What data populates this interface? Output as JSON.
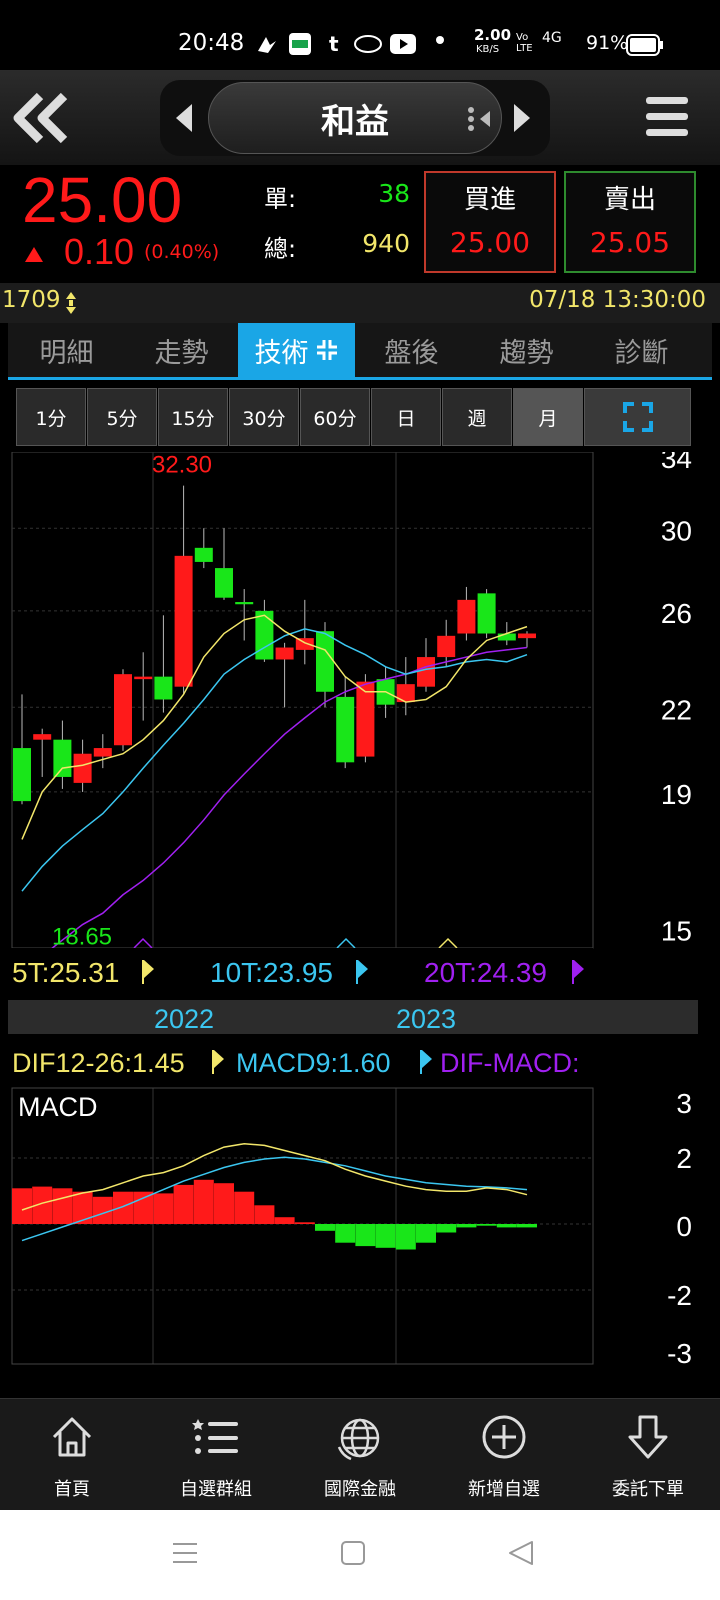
{
  "status_bar": {
    "time": "20:48",
    "net_speed_value": "2.00",
    "net_speed_unit": "KB/S",
    "volte": "Vo LTE",
    "signal": "4G",
    "battery": "91%"
  },
  "header": {
    "stock_name": "和益",
    "back_icon": "double-chevron-left-icon",
    "menu_icon": "hamburger-menu-icon"
  },
  "quote": {
    "price": "25.00",
    "change": "0.10",
    "change_pct": "(0.40%)",
    "single_label": "單:",
    "single_value": "38",
    "total_label": "總:",
    "total_value": "940",
    "buy_label": "買進",
    "buy_price": "25.00",
    "sell_label": "賣出",
    "sell_price": "25.05"
  },
  "info": {
    "code": "1709",
    "datetime": "07/18 13:30:00"
  },
  "tabs": [
    "明細",
    "走勢",
    "技術",
    "盤後",
    "趨勢",
    "診斷"
  ],
  "active_tab": 2,
  "periods": [
    "1分",
    "5分",
    "15分",
    "30分",
    "60分",
    "日",
    "週",
    "月"
  ],
  "active_period": 7,
  "indicators": {
    "ma5": "5T:25.31",
    "ma10": "10T:23.95",
    "ma20": "20T:24.39",
    "dif": "DIF12-26:1.45",
    "macd9": "MACD9:1.60",
    "dif_macd": "DIF-MACD:"
  },
  "macd_label": "MACD",
  "years": [
    "2022",
    "2023"
  ],
  "colors": {
    "up": "#ff1a1a",
    "down": "#19e619",
    "ma5": "#f2e66a",
    "ma10": "#3bc6f0",
    "ma20": "#a020f0",
    "accent": "#1aa6e6"
  },
  "chart_data": [
    {
      "type": "candlestick",
      "title": "",
      "max_label": "32.30",
      "min_label": "18.65",
      "y_ticks": [
        "34",
        "30",
        "26",
        "22",
        "19",
        "15"
      ],
      "candles": [
        {
          "o": 20.5,
          "h": 22.5,
          "l": 18.6,
          "c": 18.7
        },
        {
          "o": 20.8,
          "h": 21.2,
          "l": 19.5,
          "c": 21.0
        },
        {
          "o": 20.8,
          "h": 21.5,
          "l": 19.1,
          "c": 19.5
        },
        {
          "o": 19.3,
          "h": 20.8,
          "l": 19.0,
          "c": 20.3
        },
        {
          "o": 20.2,
          "h": 21.0,
          "l": 19.8,
          "c": 20.5
        },
        {
          "o": 20.6,
          "h": 23.5,
          "l": 20.4,
          "c": 23.3
        },
        {
          "o": 23.1,
          "h": 24.2,
          "l": 21.5,
          "c": 23.2
        },
        {
          "o": 23.2,
          "h": 25.8,
          "l": 21.8,
          "c": 22.3
        },
        {
          "o": 22.8,
          "h": 32.3,
          "l": 22.5,
          "c": 28.6
        },
        {
          "o": 29.0,
          "h": 30.0,
          "l": 28.0,
          "c": 28.3
        },
        {
          "o": 28.0,
          "h": 30.0,
          "l": 26.5,
          "c": 26.6
        },
        {
          "o": 26.4,
          "h": 27.0,
          "l": 24.7,
          "c": 26.3
        },
        {
          "o": 26.0,
          "h": 26.5,
          "l": 23.8,
          "c": 23.9
        },
        {
          "o": 23.9,
          "h": 24.6,
          "l": 22.0,
          "c": 24.4
        },
        {
          "o": 24.3,
          "h": 26.5,
          "l": 23.7,
          "c": 24.8
        },
        {
          "o": 25.1,
          "h": 25.5,
          "l": 22.0,
          "c": 22.6
        },
        {
          "o": 22.4,
          "h": 23.2,
          "l": 19.8,
          "c": 20.0
        },
        {
          "o": 20.2,
          "h": 23.3,
          "l": 20.0,
          "c": 23.0
        },
        {
          "o": 23.1,
          "h": 23.6,
          "l": 21.6,
          "c": 22.1
        },
        {
          "o": 22.2,
          "h": 24.0,
          "l": 21.7,
          "c": 22.9
        },
        {
          "o": 22.8,
          "h": 24.8,
          "l": 22.6,
          "c": 24.0
        },
        {
          "o": 24.0,
          "h": 25.6,
          "l": 23.6,
          "c": 24.9
        },
        {
          "o": 25.0,
          "h": 27.1,
          "l": 24.7,
          "c": 26.5
        },
        {
          "o": 26.8,
          "h": 27.0,
          "l": 24.8,
          "c": 25.0
        },
        {
          "o": 25.0,
          "h": 25.5,
          "l": 24.5,
          "c": 24.7
        },
        {
          "o": 24.8,
          "h": 25.1,
          "l": 24.4,
          "c": 25.0
        }
      ],
      "ma5": [
        17.5,
        19.0,
        19.8,
        19.9,
        20.1,
        20.3,
        20.8,
        21.5,
        22.5,
        24.0,
        25.0,
        25.6,
        25.8,
        25.1,
        24.6,
        24.3,
        23.2,
        22.6,
        22.6,
        22.2,
        22.3,
        22.8,
        23.9,
        24.7,
        25.0,
        25.3
      ],
      "ma10": [
        16.0,
        16.7,
        17.3,
        17.8,
        18.3,
        19.0,
        19.8,
        20.6,
        21.4,
        22.3,
        23.3,
        23.9,
        24.4,
        24.9,
        25.2,
        25.0,
        24.5,
        24.1,
        23.6,
        23.3,
        23.5,
        23.6,
        23.8,
        23.9,
        23.8,
        24.1
      ],
      "ma20": [
        null,
        14.3,
        14.7,
        15.1,
        15.4,
        15.9,
        16.3,
        16.8,
        17.4,
        18.1,
        18.9,
        19.6,
        20.3,
        21.0,
        21.6,
        22.2,
        22.6,
        22.9,
        23.1,
        23.3,
        23.6,
        23.8,
        24.0,
        24.2,
        24.3,
        24.4
      ]
    },
    {
      "type": "macd",
      "title": "",
      "y_ticks": [
        "3",
        "2",
        "0",
        "-2",
        "-3"
      ],
      "dif": [
        1.0,
        1.2,
        1.35,
        1.5,
        1.6,
        1.8,
        2.0,
        2.1,
        2.3,
        2.6,
        2.85,
        2.95,
        2.9,
        2.75,
        2.6,
        2.45,
        2.2,
        2.0,
        1.85,
        1.7,
        1.6,
        1.55,
        1.55,
        1.65,
        1.6,
        1.45
      ],
      "macd9": [
        0.1,
        0.3,
        0.5,
        0.7,
        0.9,
        1.1,
        1.35,
        1.6,
        1.85,
        2.05,
        2.25,
        2.4,
        2.5,
        2.55,
        2.5,
        2.4,
        2.3,
        2.15,
        2.0,
        1.9,
        1.8,
        1.75,
        1.7,
        1.68,
        1.65,
        1.6
      ],
      "osc": [
        1.05,
        1.1,
        1.05,
        0.95,
        0.8,
        0.95,
        0.95,
        0.9,
        1.15,
        1.3,
        1.2,
        0.95,
        0.55,
        0.2,
        0.05,
        -0.2,
        -0.55,
        -0.65,
        -0.7,
        -0.75,
        -0.55,
        -0.25,
        -0.1,
        -0.05,
        -0.1,
        -0.1
      ]
    }
  ],
  "bottom_nav": [
    {
      "label": "首頁",
      "icon": "home-icon"
    },
    {
      "label": "自選群組",
      "icon": "list-icon"
    },
    {
      "label": "國際金融",
      "icon": "globe-icon"
    },
    {
      "label": "新增自選",
      "icon": "add-circle-icon"
    },
    {
      "label": "委託下單",
      "icon": "order-arrow-icon"
    }
  ]
}
